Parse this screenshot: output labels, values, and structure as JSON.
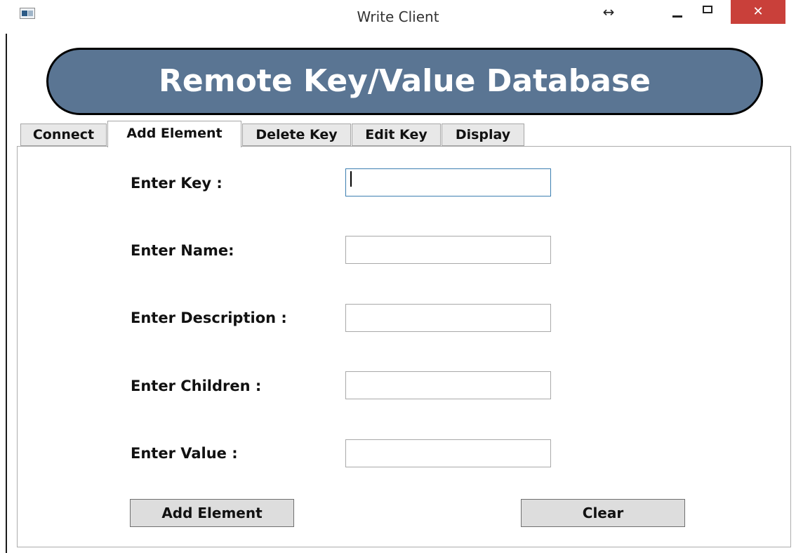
{
  "window": {
    "title": "Write Client",
    "controls": {
      "resize": "↔",
      "close": "✕"
    }
  },
  "banner": {
    "text": "Remote Key/Value Database"
  },
  "tabs": [
    {
      "label": "Connect",
      "active": false
    },
    {
      "label": "Add Element",
      "active": true
    },
    {
      "label": "Delete Key",
      "active": false
    },
    {
      "label": "Edit Key",
      "active": false
    },
    {
      "label": "Display",
      "active": false
    }
  ],
  "form": {
    "fields": [
      {
        "label": "Enter Key :",
        "value": ""
      },
      {
        "label": "Enter Name:",
        "value": ""
      },
      {
        "label": "Enter Description :",
        "value": ""
      },
      {
        "label": "Enter Children :",
        "value": ""
      },
      {
        "label": "Enter Value :",
        "value": ""
      }
    ],
    "add_button": "Add Element",
    "clear_button": "Clear"
  },
  "colors": {
    "banner": "#5a7593",
    "close": "#c9403a",
    "focus_border": "#3c7fb1"
  }
}
